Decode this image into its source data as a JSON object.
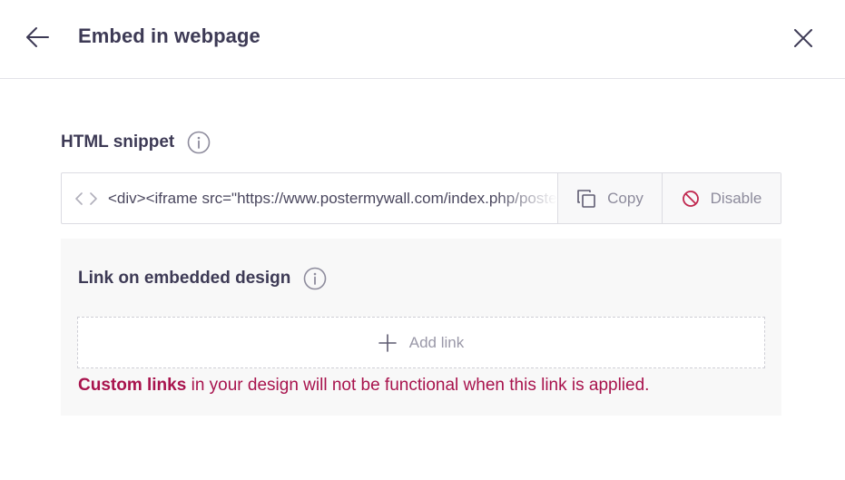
{
  "header": {
    "title": "Embed in webpage"
  },
  "snippet": {
    "label": "HTML snippet",
    "code": "<div><iframe src=\"https://www.postermywall.com/index.php/posterbuilder/embed\"></iframe></div>",
    "copy_label": "Copy",
    "disable_label": "Disable"
  },
  "link_section": {
    "label": "Link on embedded design",
    "add_link_label": "Add link",
    "warning_strong": "Custom links",
    "warning_rest": " in your design will not be functional when this link is applied."
  },
  "colors": {
    "text_primary": "#3d3a55",
    "muted": "#8d8b9c",
    "warning": "#a8134d",
    "disable_icon": "#c0284f",
    "panel_bg": "#f8f8f8",
    "border": "#dcdce2"
  },
  "icons": {
    "back": "arrow-left-icon",
    "close": "close-icon",
    "info": "info-icon",
    "code": "code-brackets-icon",
    "copy": "copy-icon",
    "disable": "ban-icon",
    "add": "plus-icon"
  }
}
